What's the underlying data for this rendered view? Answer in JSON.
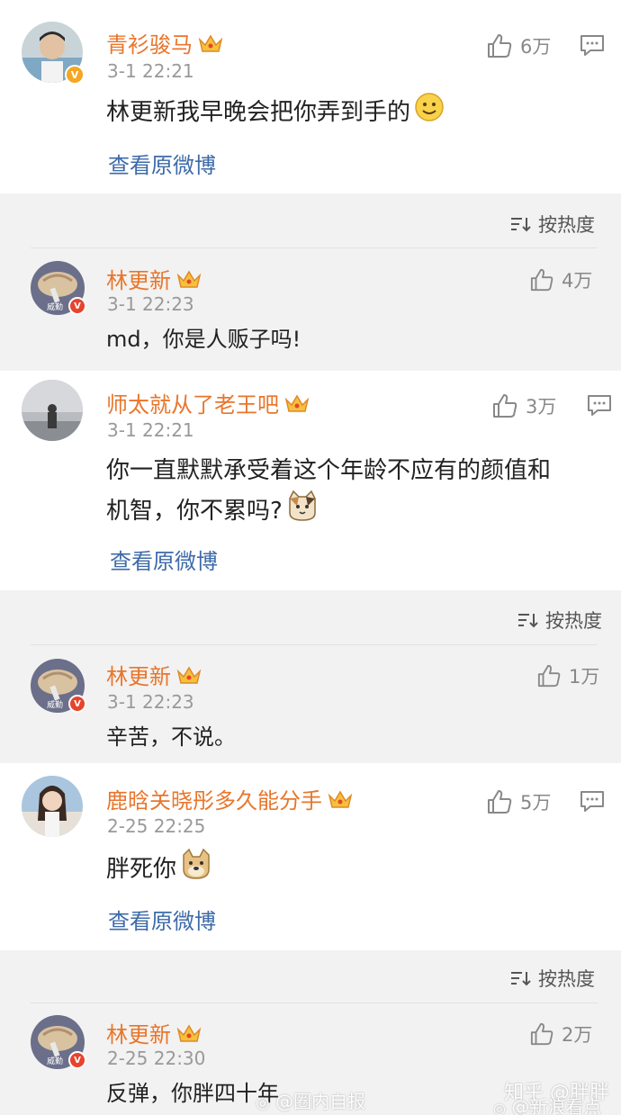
{
  "comments": [
    {
      "username": "青衫骏马",
      "time": "3-1 22:21",
      "content": "林更新我早晚会把你弄到手的",
      "likes": "6万",
      "view_original": "查看原微博"
    },
    {
      "username": "师太就从了老王吧",
      "time": "3-1 22:21",
      "content_line1": "你一直默默承受着这个年龄不应有的颜值和",
      "content_line2": "机智，你不累吗?",
      "likes": "3万",
      "view_original": "查看原微博"
    },
    {
      "username": "鹿晗关晓彤多久能分手",
      "time": "2-25 22:25",
      "content": "胖死你",
      "likes": "5万",
      "view_original": "查看原微博"
    }
  ],
  "replies": [
    {
      "username": "林更新",
      "time": "3-1 22:23",
      "content": "md，你是人贩子吗!",
      "likes": "4万"
    },
    {
      "username": "林更新",
      "time": "3-1 22:23",
      "content": "辛苦，不说。",
      "likes": "1万"
    },
    {
      "username": "林更新",
      "time": "2-25 22:30",
      "content": "反弹，你胖四十年",
      "likes": "2万"
    }
  ],
  "sort_label": "按热度",
  "avatar_caption": "威勤",
  "watermark": {
    "left": "@圈内自报",
    "right_line1": "知乎 @胖胖",
    "right_line2": "@新浪看点"
  },
  "colors": {
    "username": "#e8762c",
    "link": "#3d6aa8",
    "muted": "#999999",
    "background_gap": "#f2f2f2"
  }
}
